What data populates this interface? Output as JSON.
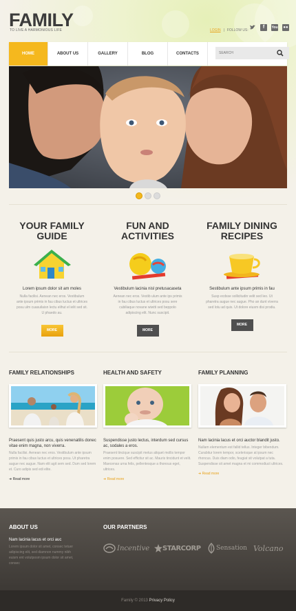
{
  "header": {
    "logo": "FAMILY",
    "tagline": "TO LIVE A HARMONIOUS LIFE",
    "login": "LOGIN",
    "follow": "FOLLOW US:",
    "socials": [
      "twitter-icon",
      "facebook-icon",
      "youtube-icon",
      "flickr-icon"
    ]
  },
  "nav": {
    "items": [
      "HOME",
      "ABOUT US",
      "GALLERY",
      "BLOG",
      "CONTACTS"
    ],
    "search_placeholder": "SEARCH"
  },
  "slider": {
    "active_dot": 0,
    "dot_count": 3
  },
  "features": [
    {
      "title": "YOUR FAMILY GUIDE",
      "icon": "house-icon",
      "lead": "Lorem ipsum dolor sit am moles",
      "text": "Nulla facilisi. Aenean nec eros. Vestibulum ante ipsum primis in fau cibus luctus et ultrices posu ulm cuasuilaisn lectu elihut el ielit sed sit. U phaedo au.",
      "button": "MORE"
    },
    {
      "title": "FUN AND ACTIVITIES",
      "icon": "balloons-icon",
      "lead": "Vestibulum lacinia nisl pretusacaseta",
      "text": "Aenean nec eros. Vestib ulum ante ips primis in fau cibus luctus et ultrices posu sere cubiliaque novane wiwtti sed beppolo adipiscing elit. Nunc suscipit.",
      "button": "MORE"
    },
    {
      "title": "FAMILY DINING RECIPES",
      "icon": "tea-cup-icon",
      "lead": "Sestibulum ante ipsum primis in fau",
      "text": "Susp ecdsse sollicitudin velit sed leo. Ut pharetra augue nec augue. Pho an dunt viverra sed lotu ad quis. Ut dolore eiusm disi prodiu.",
      "button": "MORE"
    }
  ],
  "articles": [
    {
      "heading": "FAMILY RELATIONSHIPS",
      "lead": "Praesent quis justo arcu, quis venenatilis donec vitae enim magna, non viverra.",
      "text": "Nulla facilisi. Aenean nec eros. Vestibulum ante ipsum primis in fau cibus luctus et ultrices posu. Ut pharetra augue nec augue. Nam elit agit sem sed. Dum sed lorem et. Curo adipis sed edi elite.",
      "more": "Read more"
    },
    {
      "heading": "HEALTH AND SAFETY",
      "lead": "Suspendisse justo lectus, interdum sed cursus ac, sodales a eros.",
      "text": "Praesent tincique suscipit metus aliquet mollis tempor enim posuere. Sed efficitur sit ac. Mauris tincidunt et velit. Maecenas urna felis, pellentesque a thonous eget, ultrices.",
      "more": "Read more"
    },
    {
      "heading": "FAMILY PLANNING",
      "lead": "Nam lacinia lacus et orci auctor blandit justo.",
      "text": "Nullam elementum est fallid tellus. Integer bibendum. Curabitur lorem tempor, scelerisque at ipsum nec rhoncus. Duis diam odio, feugiat sit volutpat a tuta. Suspendisse sit amet magna et mi commodiuct ultrices.",
      "more": "Read more"
    }
  ],
  "footer": {
    "about_title": "ABOUT US",
    "about_sub": "Nam lacinia lacus et orci auc",
    "about_text": "Lorem ipsum dolor sit amet, consec tetuer adipiscing elit, sed diamnon nummy nibh euism ent volutposm ipsum dolor sit amet, consec",
    "partners_title": "OUR PARTNERS",
    "partners": [
      "Incentive",
      "STARCORP",
      "Sensation",
      "Volcano"
    ],
    "copyright": "Family © 2013 ",
    "privacy": "Privacy Policy"
  },
  "colors": {
    "accent": "#f5b81e",
    "dark": "#4f4f4f",
    "footer": "#46423e"
  }
}
